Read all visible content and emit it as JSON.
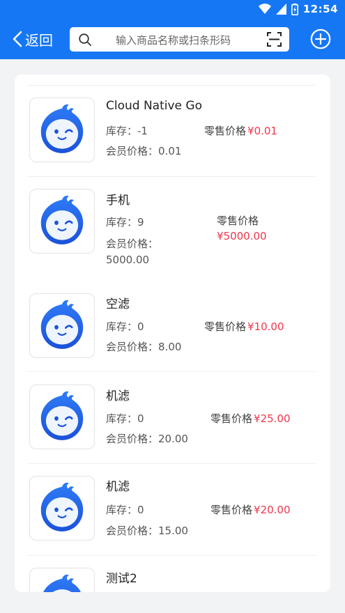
{
  "status": {
    "time": "12:54"
  },
  "header": {
    "back_label": "返回",
    "search_placeholder": "输入商品名称或扫条形码"
  },
  "labels": {
    "stock": "库存：",
    "retail": "零售价格",
    "member": "会员价格：",
    "currency": "¥"
  },
  "products": [
    {
      "name": "Cloud Native Go",
      "stock": "-1",
      "retail_price": "0.01",
      "member_price": "0.01"
    },
    {
      "name": "手机",
      "stock": "9",
      "retail_price": "5000.00",
      "member_price": "5000.00"
    },
    {
      "name": "空滤",
      "stock": "0",
      "retail_price": "10.00",
      "member_price": "8.00"
    },
    {
      "name": "机滤",
      "stock": "0",
      "retail_price": "25.00",
      "member_price": "20.00"
    },
    {
      "name": "机滤",
      "stock": "0",
      "retail_price": "20.00",
      "member_price": "15.00"
    },
    {
      "name": "测试2"
    }
  ],
  "colors": {
    "primary": "#1677f5",
    "price": "#f0364b"
  }
}
